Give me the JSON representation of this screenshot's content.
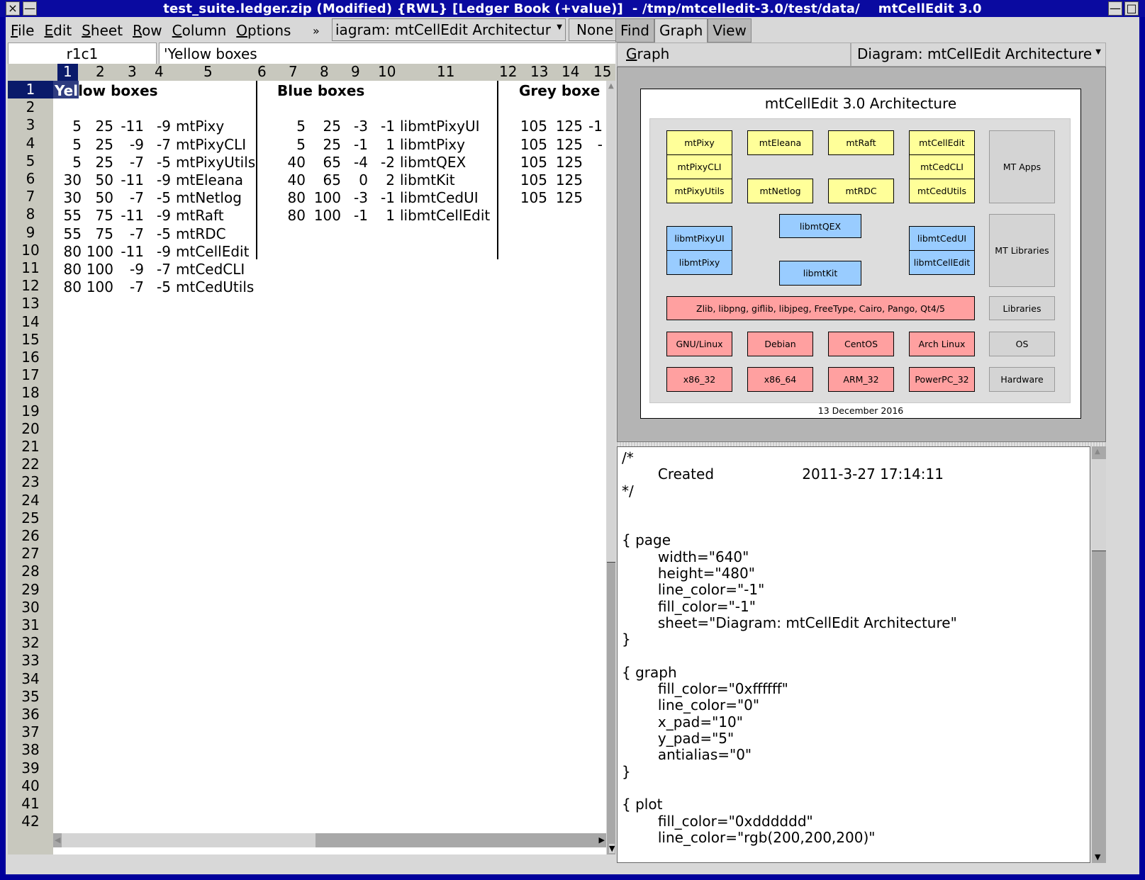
{
  "window": {
    "title": "test_suite.ledger.zip (Modified) {RWL} [Ledger Book (+value)]  - /tmp/mtcelledit-3.0/test/data/    mtCellEdit 3.0",
    "close_icon": "×",
    "minimize_icon": "—",
    "maximize_icon": "□"
  },
  "menubar": {
    "items": [
      {
        "label": "File",
        "mnemonic": "F"
      },
      {
        "label": "Edit",
        "mnemonic": "E"
      },
      {
        "label": "Sheet",
        "mnemonic": "S"
      },
      {
        "label": "Row",
        "mnemonic": "R"
      },
      {
        "label": "Column",
        "mnemonic": "C"
      },
      {
        "label": "Options",
        "mnemonic": "O"
      }
    ],
    "overflow": "»",
    "sheet_select": "iagram: mtCellEdit Architectur",
    "filter_select": "None"
  },
  "formula_bar": {
    "cell_ref": "r1c1",
    "cell_value": "'Yellow boxes"
  },
  "sheet": {
    "selected_row": 1,
    "selected_col": 1,
    "column_headers": [
      "1",
      "2",
      "3",
      "4",
      "5",
      "6",
      "7",
      "8",
      "9",
      "10",
      "11",
      "12",
      "13",
      "14",
      "15"
    ],
    "row_headers": [
      "1",
      "2",
      "3",
      "4",
      "5",
      "6",
      "7",
      "8",
      "9",
      "10",
      "11",
      "12",
      "13",
      "14",
      "15",
      "16",
      "17",
      "18",
      "19",
      "20",
      "21",
      "22",
      "23",
      "24",
      "25",
      "26",
      "27",
      "28",
      "29",
      "30",
      "31",
      "32",
      "33",
      "34",
      "35",
      "36",
      "37",
      "38",
      "39",
      "40",
      "41",
      "42"
    ],
    "headings": {
      "yellow": "Yellow boxes",
      "blue": "Blue boxes",
      "grey": "Grey boxe"
    },
    "yellow_rows": [
      [
        "5",
        "25",
        "-11",
        "-9",
        "mtPixy"
      ],
      [
        "5",
        "25",
        "-9",
        "-7",
        "mtPixyCLI"
      ],
      [
        "5",
        "25",
        "-7",
        "-5",
        "mtPixyUtils"
      ],
      [
        "30",
        "50",
        "-11",
        "-9",
        "mtEleana"
      ],
      [
        "30",
        "50",
        "-7",
        "-5",
        "mtNetlog"
      ],
      [
        "55",
        "75",
        "-11",
        "-9",
        "mtRaft"
      ],
      [
        "55",
        "75",
        "-7",
        "-5",
        "mtRDC"
      ],
      [
        "80",
        "100",
        "-11",
        "-9",
        "mtCellEdit"
      ],
      [
        "80",
        "100",
        "-9",
        "-7",
        "mtCedCLI"
      ],
      [
        "80",
        "100",
        "-7",
        "-5",
        "mtCedUtils"
      ]
    ],
    "blue_rows": [
      [
        "5",
        "25",
        "-3",
        "-1",
        "libmtPixyUI"
      ],
      [
        "5",
        "25",
        "-1",
        "1",
        "libmtPixy"
      ],
      [
        "40",
        "65",
        "-4",
        "-2",
        "libmtQEX"
      ],
      [
        "40",
        "65",
        "0",
        "2",
        "libmtKit"
      ],
      [
        "80",
        "100",
        "-3",
        "-1",
        "libmtCedUI"
      ],
      [
        "80",
        "100",
        "-1",
        "1",
        "libmtCellEdit"
      ]
    ],
    "grey_rows": [
      [
        "105",
        "125",
        "-1"
      ],
      [
        "105",
        "125",
        "-"
      ],
      [
        "105",
        "125",
        ""
      ],
      [
        "105",
        "125",
        ""
      ],
      [
        "105",
        "125",
        ""
      ]
    ]
  },
  "right_panel": {
    "tabs": [
      {
        "label": "Find",
        "active": false
      },
      {
        "label": "Graph",
        "active": true
      },
      {
        "label": "View",
        "active": false
      }
    ],
    "graph_label": "Graph",
    "graph_mnemonic": "G",
    "diagram_select": "Diagram: mtCellEdit Architecture"
  },
  "diagram": {
    "title": "mtCellEdit 3.0 Architecture",
    "date": "13 December 2016",
    "colors": {
      "yellow": "#ffff99",
      "blue": "#99ccff",
      "red": "#ffa0a0",
      "grey": "#d4d4d4",
      "plot": "#dddddd"
    },
    "boxes": {
      "mtPixy": "mtPixy",
      "mtPixyCLI": "mtPixyCLI",
      "mtPixyUtils": "mtPixyUtils",
      "mtEleana": "mtEleana",
      "mtNetlog": "mtNetlog",
      "mtRaft": "mtRaft",
      "mtRDC": "mtRDC",
      "mtCellEdit": "mtCellEdit",
      "mtCedCLI": "mtCedCLI",
      "mtCedUtils": "mtCedUtils",
      "libmtPixyUI": "libmtPixyUI",
      "libmtPixy": "libmtPixy",
      "libmtQEX": "libmtQEX",
      "libmtKit": "libmtKit",
      "libmtCedUI": "libmtCedUI",
      "libmtCellEdit": "libmtCellEdit",
      "libs": "Zlib, libpng, giflib, libjpeg, FreeType, Cairo, Pango, Qt4/5",
      "gnulinux": "GNU/Linux",
      "debian": "Debian",
      "centos": "CentOS",
      "arch": "Arch Linux",
      "x86_32": "x86_32",
      "x86_64": "x86_64",
      "arm_32": "ARM_32",
      "ppc_32": "PowerPC_32",
      "mt_apps": "MT Apps",
      "mt_libraries": "MT Libraries",
      "libraries": "Libraries",
      "os": "OS",
      "hardware": "Hardware"
    }
  },
  "source_text": "/*\n\tCreated\t\t\t2011-3-27 17:14:11\n*/\n\n\n{ page\n\twidth=\"640\"\n\theight=\"480\"\n\tline_color=\"-1\"\n\tfill_color=\"-1\"\n\tsheet=\"Diagram: mtCellEdit Architecture\"\n}\n\n{ graph\n\tfill_color=\"0xffffff\"\n\tline_color=\"0\"\n\tx_pad=\"10\"\n\ty_pad=\"5\"\n\tantialias=\"0\"\n}\n\n{ plot\n\tfill_color=\"0xdddddd\"\n\tline_color=\"rgb(200,200,200)\""
}
